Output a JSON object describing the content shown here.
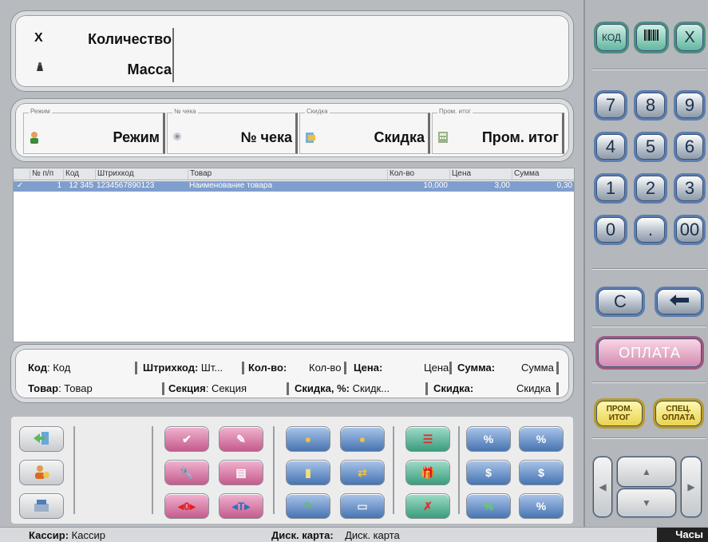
{
  "input": {
    "qty_symbol": "X",
    "qty_label": "Количество",
    "mass_label": "Масса"
  },
  "info": {
    "mode": {
      "legend": "Режим",
      "value": "Режим"
    },
    "check": {
      "legend": "№ чека",
      "value": "№ чека"
    },
    "discount": {
      "legend": "Скидка",
      "value": "Скидка"
    },
    "subtotal": {
      "legend": "Пром. итог",
      "value": "Пром. итог"
    }
  },
  "table": {
    "headers": [
      "№ п/п",
      "Код",
      "Штрихкод",
      "Товар",
      "Кол-во",
      "Цена",
      "Сумма"
    ],
    "rows": [
      {
        "check": "✓",
        "num": "1",
        "code": "12 345",
        "barcode": "1234567890123",
        "product": "Наименование товара",
        "qty": "10,000",
        "price": "3,00",
        "sum": "0,30"
      }
    ]
  },
  "details": {
    "code_label": "Код",
    "code_value": "Код",
    "barcode_label": "Штрихкод:",
    "barcode_value": "Шт...",
    "qty_label": "Кол-во:",
    "qty_value": "Кол-во",
    "price_label": "Цена:",
    "price_value": "Цена",
    "sum_label": "Сумма:",
    "sum_value": "Сумма",
    "product_label": "Товар",
    "product_value": "Товар",
    "section_label": "Секция",
    "section_value": "Секция",
    "discountpct_label": "Скидка, %:",
    "discountpct_value": "Скидк...",
    "discount_label": "Скидка:",
    "discount_value": "Скидка"
  },
  "status": {
    "cashier_label": "Кассир:",
    "cashier_value": "Кассир",
    "card_label": "Диск. карта:",
    "card_value": "Диск. карта",
    "clock": "Часы"
  },
  "keypad": {
    "code": "КОД",
    "close": "X",
    "keys": [
      "7",
      "8",
      "9",
      "4",
      "5",
      "6",
      "1",
      "2",
      "3",
      "0",
      ".",
      "00"
    ],
    "clear": "C",
    "payment": "ОПЛАТА",
    "subtotal_1": "ПРОМ.",
    "subtotal_2": "ИТОГ",
    "special_1": "СПЕЦ.",
    "special_2": "ОПЛАТА"
  }
}
